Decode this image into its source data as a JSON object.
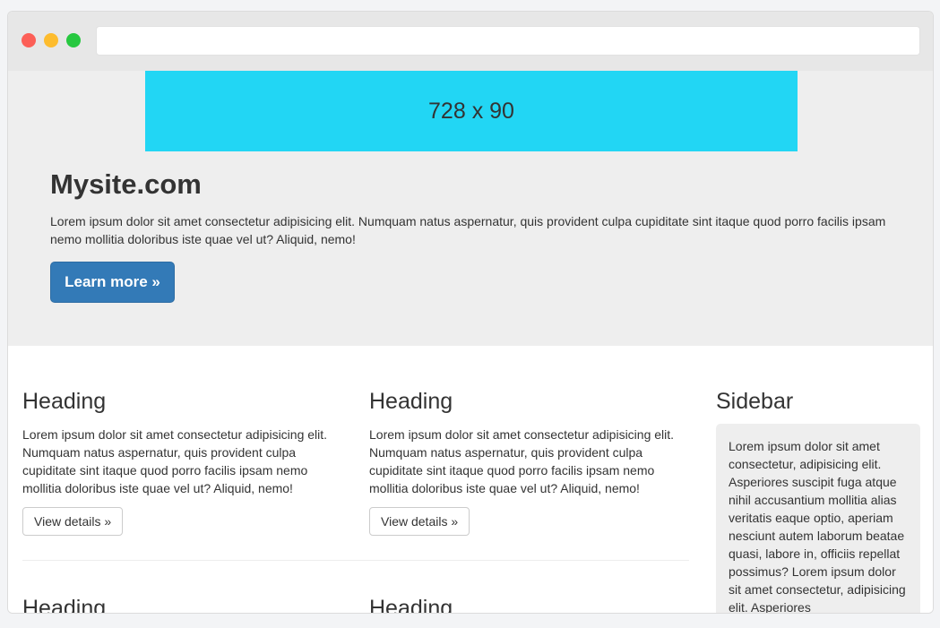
{
  "browser": {
    "address_value": ""
  },
  "ad": {
    "label": "728 x 90",
    "color": "#22d6f4"
  },
  "hero": {
    "title": "Mysite.com",
    "text": "Lorem ipsum dolor sit amet consectetur adipisicing elit. Numquam natus aspernatur, quis provident culpa cupiditate sint itaque quod porro facilis ipsam nemo mollitia doloribus iste quae vel ut? Aliquid, nemo!",
    "button_label": "Learn more »",
    "button_color": "#337ab7"
  },
  "columns": [
    {
      "heading": "Heading",
      "text": "Lorem ipsum dolor sit amet consectetur adipisicing elit. Numquam natus aspernatur, quis provident culpa cupiditate sint itaque quod porro facilis ipsam nemo mollitia doloribus iste quae vel ut? Aliquid, nemo!",
      "button_label": "View details »"
    },
    {
      "heading": "Heading",
      "text": "Lorem ipsum dolor sit amet consectetur adipisicing elit. Numquam natus aspernatur, quis provident culpa cupiditate sint itaque quod porro facilis ipsam nemo mollitia doloribus iste quae vel ut? Aliquid, nemo!",
      "button_label": "View details »"
    },
    {
      "heading": "Heading"
    },
    {
      "heading": "Heading"
    }
  ],
  "sidebar": {
    "title": "Sidebar",
    "text": "Lorem ipsum dolor sit amet consectetur, adipisicing elit. Asperiores suscipit fuga atque nihil accusantium mollitia alias veritatis eaque optio, aperiam nesciunt autem laborum beatae quasi, labore in, officiis repellat possimus? Lorem ipsum dolor sit amet consectetur, adipisicing elit. Asperiores"
  }
}
